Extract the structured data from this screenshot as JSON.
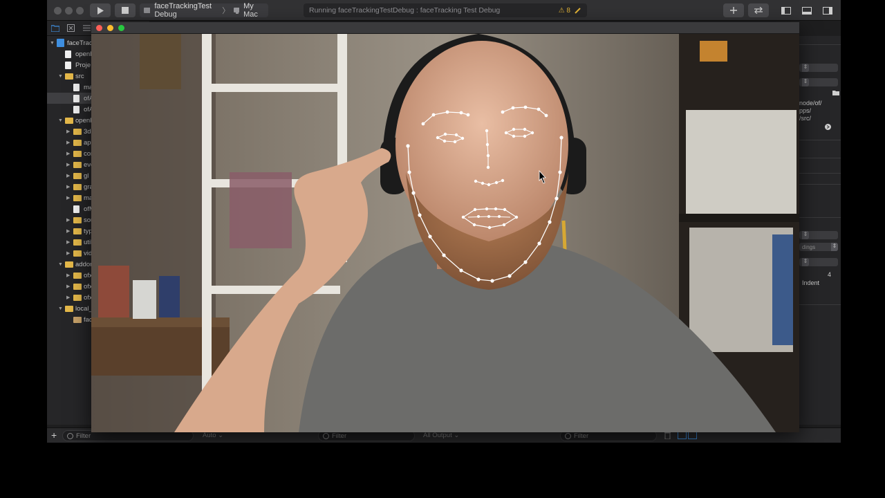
{
  "toolbar": {
    "scheme": "faceTrackingTest Debug",
    "destination": "My Mac",
    "status": "Running faceTrackingTestDebug : faceTracking Test Debug",
    "warning_count": "⚠ 8"
  },
  "navigator": {
    "items": [
      {
        "label": "faceTrac",
        "kind": "project",
        "level": 0,
        "disc": "▼"
      },
      {
        "label": "openF",
        "kind": "file",
        "level": 1,
        "disc": ""
      },
      {
        "label": "Proje",
        "kind": "file",
        "level": 1,
        "disc": ""
      },
      {
        "label": "src",
        "kind": "folder",
        "level": 1,
        "disc": "▼"
      },
      {
        "label": "ma",
        "kind": "file",
        "level": 2,
        "disc": ""
      },
      {
        "label": "ofA",
        "kind": "file",
        "level": 2,
        "disc": "",
        "selected": true
      },
      {
        "label": "ofA",
        "kind": "file",
        "level": 2,
        "disc": ""
      },
      {
        "label": "openF",
        "kind": "folder",
        "level": 1,
        "disc": "▼"
      },
      {
        "label": "3d",
        "kind": "folder",
        "level": 2,
        "disc": "▶"
      },
      {
        "label": "app",
        "kind": "folder",
        "level": 2,
        "disc": "▶"
      },
      {
        "label": "com",
        "kind": "folder",
        "level": 2,
        "disc": "▶"
      },
      {
        "label": "eve",
        "kind": "folder",
        "level": 2,
        "disc": "▶"
      },
      {
        "label": "gl",
        "kind": "folder",
        "level": 2,
        "disc": "▶"
      },
      {
        "label": "gra",
        "kind": "folder",
        "level": 2,
        "disc": "▶"
      },
      {
        "label": "ma",
        "kind": "folder",
        "level": 2,
        "disc": "▶"
      },
      {
        "label": "ofM",
        "kind": "file",
        "level": 2,
        "disc": ""
      },
      {
        "label": "sou",
        "kind": "folder",
        "level": 2,
        "disc": "▶"
      },
      {
        "label": "typ",
        "kind": "folder",
        "level": 2,
        "disc": "▶"
      },
      {
        "label": "util",
        "kind": "folder",
        "level": 2,
        "disc": "▶"
      },
      {
        "label": "vid",
        "kind": "folder",
        "level": 2,
        "disc": "▶"
      },
      {
        "label": "addon",
        "kind": "folder",
        "level": 1,
        "disc": "▼"
      },
      {
        "label": "ofx",
        "kind": "folder",
        "level": 2,
        "disc": "▶"
      },
      {
        "label": "ofx",
        "kind": "folder",
        "level": 2,
        "disc": "▶"
      },
      {
        "label": "ofx",
        "kind": "folder",
        "level": 2,
        "disc": "▶"
      },
      {
        "label": "local_",
        "kind": "folder",
        "level": 1,
        "disc": "▼"
      },
      {
        "label": "faceT",
        "kind": "app",
        "level": 2,
        "disc": ""
      }
    ]
  },
  "bottom": {
    "add": "+",
    "filter": "Filter",
    "auto": "Auto ⌄",
    "filter2": "Filter",
    "all_output": "All Output ⌄",
    "filter3": "Filter"
  },
  "inspector": {
    "path_lines": [
      "node/of/",
      "pps/",
      "/src/"
    ],
    "indent_label": "Indent",
    "indent_value": "4",
    "popup_text": "dings"
  },
  "colors": {
    "accent": "#3f8fe0",
    "folder": "#e5b94a",
    "warning": "#e2b437"
  }
}
